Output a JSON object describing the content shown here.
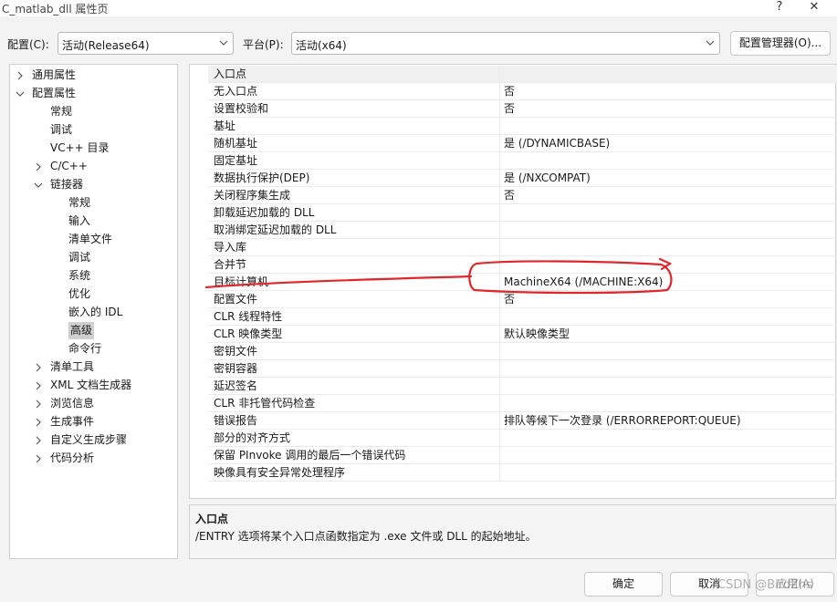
{
  "window": {
    "title": "C_matlab_dll 属性页",
    "help_glyph": "?",
    "close_glyph": "✕"
  },
  "toolbar": {
    "config_label": "配置(C):",
    "config_value": "活动(Release64)",
    "platform_label": "平台(P):",
    "platform_value": "活动(x64)",
    "manager_label": "配置管理器(O)..."
  },
  "tree": {
    "items": [
      {
        "label": "通用属性",
        "level": 0,
        "expander": "collapsed"
      },
      {
        "label": "配置属性",
        "level": 0,
        "expander": "expanded"
      },
      {
        "label": "常规",
        "level": 1,
        "expander": "none"
      },
      {
        "label": "调试",
        "level": 1,
        "expander": "none"
      },
      {
        "label": "VC++ 目录",
        "level": 1,
        "expander": "none"
      },
      {
        "label": "C/C++",
        "level": 1,
        "expander": "collapsed"
      },
      {
        "label": "链接器",
        "level": 1,
        "expander": "expanded"
      },
      {
        "label": "常规",
        "level": 2,
        "expander": "none"
      },
      {
        "label": "输入",
        "level": 2,
        "expander": "none"
      },
      {
        "label": "清单文件",
        "level": 2,
        "expander": "none"
      },
      {
        "label": "调试",
        "level": 2,
        "expander": "none"
      },
      {
        "label": "系统",
        "level": 2,
        "expander": "none"
      },
      {
        "label": "优化",
        "level": 2,
        "expander": "none"
      },
      {
        "label": "嵌入的 IDL",
        "level": 2,
        "expander": "none"
      },
      {
        "label": "高级",
        "level": 2,
        "expander": "none",
        "selected": true
      },
      {
        "label": "命令行",
        "level": 2,
        "expander": "none"
      },
      {
        "label": "清单工具",
        "level": 1,
        "expander": "collapsed"
      },
      {
        "label": "XML 文档生成器",
        "level": 1,
        "expander": "collapsed"
      },
      {
        "label": "浏览信息",
        "level": 1,
        "expander": "collapsed"
      },
      {
        "label": "生成事件",
        "level": 1,
        "expander": "collapsed"
      },
      {
        "label": "自定义生成步骤",
        "level": 1,
        "expander": "collapsed"
      },
      {
        "label": "代码分析",
        "level": 1,
        "expander": "collapsed"
      }
    ]
  },
  "grid": {
    "rows": [
      {
        "name": "入口点",
        "value": "",
        "highlight": true
      },
      {
        "name": "无入口点",
        "value": "否"
      },
      {
        "name": "设置校验和",
        "value": "否"
      },
      {
        "name": "基址",
        "value": ""
      },
      {
        "name": "随机基址",
        "value": "是 (/DYNAMICBASE)"
      },
      {
        "name": "固定基址",
        "value": ""
      },
      {
        "name": "数据执行保护(DEP)",
        "value": "是 (/NXCOMPAT)"
      },
      {
        "name": "关闭程序集生成",
        "value": "否"
      },
      {
        "name": "卸载延迟加载的 DLL",
        "value": ""
      },
      {
        "name": "取消绑定延迟加载的 DLL",
        "value": ""
      },
      {
        "name": "导入库",
        "value": ""
      },
      {
        "name": "合并节",
        "value": ""
      },
      {
        "name": "目标计算机",
        "value": "MachineX64 (/MACHINE:X64)"
      },
      {
        "name": "配置文件",
        "value": "否"
      },
      {
        "name": "CLR 线程特性",
        "value": ""
      },
      {
        "name": "CLR 映像类型",
        "value": "默认映像类型"
      },
      {
        "name": "密钥文件",
        "value": ""
      },
      {
        "name": "密钥容器",
        "value": ""
      },
      {
        "name": "延迟签名",
        "value": ""
      },
      {
        "name": "CLR 非托管代码检查",
        "value": ""
      },
      {
        "name": "错误报告",
        "value": "排队等候下一次登录 (/ERRORREPORT:QUEUE)"
      },
      {
        "name": "部分的对齐方式",
        "value": ""
      },
      {
        "name": "保留 PInvoke 调用的最后一个错误代码",
        "value": ""
      },
      {
        "name": "映像具有安全异常处理程序",
        "value": ""
      }
    ]
  },
  "description": {
    "title": "入口点",
    "text": "/ENTRY 选项将某个入口点函数指定为 .exe 文件或 DLL 的起始地址。"
  },
  "buttons": {
    "ok": "确定",
    "cancel": "取消",
    "apply": "应用(A)"
  },
  "watermark": "CSDN @BirdZhs",
  "colors": {
    "annotation": "#e0262b",
    "selection": "#cfcfcf",
    "header_row": "#f0f0f0"
  }
}
